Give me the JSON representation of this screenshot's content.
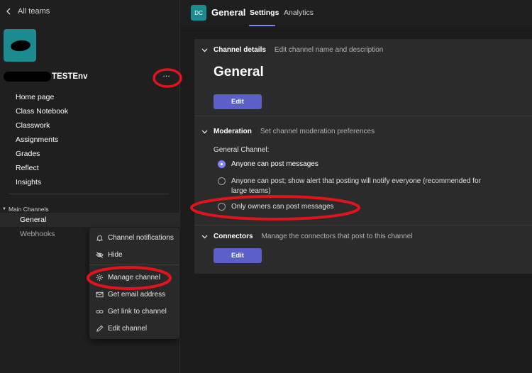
{
  "sidebar": {
    "back_label": "All teams",
    "team_name": "TESTEnv",
    "more_label": "…",
    "nav_items": [
      {
        "label": "Home page"
      },
      {
        "label": "Class Notebook"
      },
      {
        "label": "Classwork"
      },
      {
        "label": "Assignments"
      },
      {
        "label": "Grades"
      },
      {
        "label": "Reflect"
      },
      {
        "label": "Insights"
      }
    ],
    "section_label": "Main Channels",
    "channels": [
      {
        "label": "General",
        "active": true
      },
      {
        "label": "Webhooks",
        "active": false
      }
    ]
  },
  "context_menu": {
    "items": [
      {
        "label": "Channel notifications",
        "icon": "bell-icon"
      },
      {
        "label": "Hide",
        "icon": "eye-off-icon"
      },
      {
        "label": "Manage channel",
        "icon": "gear-icon"
      },
      {
        "label": "Get email address",
        "icon": "mail-icon"
      },
      {
        "label": "Get link to channel",
        "icon": "link-icon"
      },
      {
        "label": "Edit channel",
        "icon": "pencil-icon"
      }
    ]
  },
  "header": {
    "avatar_initials": "DC",
    "channel_name": "General",
    "tabs": [
      {
        "label": "Settings",
        "active": true
      },
      {
        "label": "Analytics",
        "active": false
      }
    ]
  },
  "settings": {
    "channel_details": {
      "title": "Channel details",
      "description": "Edit channel name and description",
      "channel_name": "General",
      "edit_label": "Edit"
    },
    "moderation": {
      "title": "Moderation",
      "description": "Set channel moderation preferences",
      "group_label": "General Channel:",
      "options": [
        {
          "label": "Anyone can post messages",
          "selected": true
        },
        {
          "label": "Anyone can post; show alert that posting will notify everyone (recommended for large teams)",
          "selected": false
        },
        {
          "label": "Only owners can post messages",
          "selected": false
        }
      ]
    },
    "connectors": {
      "title": "Connectors",
      "description": "Manage the connectors that post to this channel",
      "edit_label": "Edit"
    }
  },
  "colors": {
    "accent": "#5b5fc7",
    "radio_selected": "#7f85f5",
    "team_avatar": "#1b8b8f",
    "annotation": "#e0141c"
  }
}
